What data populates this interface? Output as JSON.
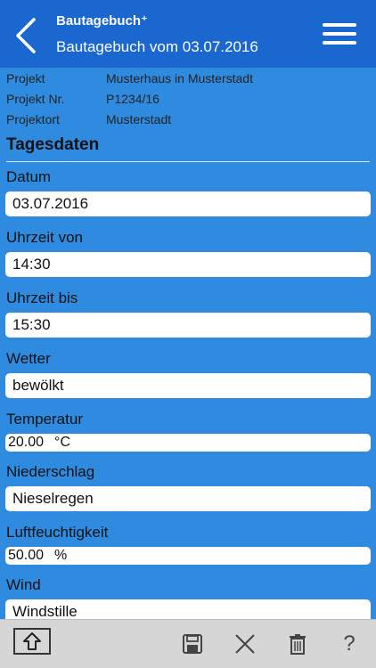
{
  "header": {
    "app_title": "Bautagebuch⁺",
    "subtitle": "Bautagebuch vom 03.07.2016"
  },
  "project_info": [
    {
      "label": "Projekt",
      "value": "Musterhaus in Musterstadt"
    },
    {
      "label": "Projekt Nr.",
      "value": "P1234/16"
    },
    {
      "label": "Projektort",
      "value": "Musterstadt"
    }
  ],
  "section": {
    "title": "Tagesdaten"
  },
  "fields": {
    "datum": {
      "label": "Datum",
      "value": "03.07.2016"
    },
    "uhrzeit_von": {
      "label": "Uhrzeit von",
      "value": "14:30"
    },
    "uhrzeit_bis": {
      "label": "Uhrzeit bis",
      "value": "15:30"
    },
    "wetter": {
      "label": "Wetter",
      "value": "bewölkt"
    },
    "temperatur": {
      "label": "Temperatur",
      "value": "20.00",
      "unit": "°C"
    },
    "niederschlag": {
      "label": "Niederschlag",
      "value": "Nieselregen"
    },
    "luftfeuchtigkeit": {
      "label": "Luftfeuchtigkeit",
      "value": "50.00",
      "unit": "%"
    },
    "wind": {
      "label": "Wind",
      "value": "Windstille"
    }
  },
  "toolbar": {
    "icons": [
      "upload-icon",
      "save-icon",
      "close-icon",
      "trash-icon",
      "help-icon"
    ],
    "help_label": "?"
  },
  "colors": {
    "header_bg": "#1a67cf",
    "body_bg": "#2f8be0",
    "toolbar_bg": "#d6d6d6"
  }
}
